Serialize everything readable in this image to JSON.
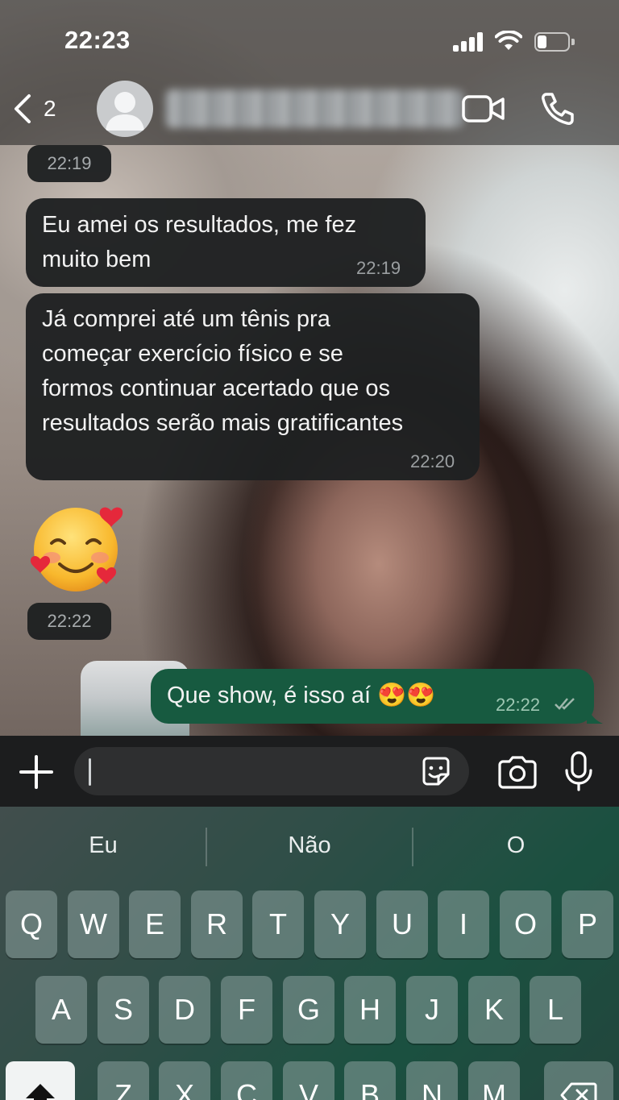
{
  "status_bar": {
    "time": "22:23"
  },
  "header": {
    "back_count": "2",
    "contact_name": "Ana Paula Rodrigues"
  },
  "messages": [
    {
      "type": "time",
      "time": "22:19"
    },
    {
      "type": "in",
      "text": "Eu amei os resultados, me fez\nmuito bem",
      "time": "22:19"
    },
    {
      "type": "in",
      "text": "Já comprei até um tênis pra\ncomeçar exercício físico e se\nformos continuar acertado que os\nresultados serão mais gratificantes",
      "time": "22:20"
    },
    {
      "type": "sticker",
      "emoji": "🥰",
      "time": "22:22"
    },
    {
      "type": "out",
      "text": "Que show, é isso aí 😍😍",
      "time": "22:22",
      "status": "read"
    }
  ],
  "input": {
    "value": "",
    "placeholder": ""
  },
  "keyboard": {
    "suggestions": [
      "Eu",
      "Não",
      "O"
    ],
    "row1": [
      "Q",
      "W",
      "E",
      "R",
      "T",
      "Y",
      "U",
      "I",
      "O",
      "P"
    ],
    "row2": [
      "A",
      "S",
      "D",
      "F",
      "G",
      "H",
      "J",
      "K",
      "L"
    ],
    "row3": [
      "Z",
      "X",
      "C",
      "V",
      "B",
      "N",
      "M"
    ]
  },
  "icons": {
    "back": "chevron-left-icon",
    "video": "video-camera-icon",
    "phone": "phone-icon",
    "plus": "plus-icon",
    "sticker": "sticker-icon",
    "camera": "camera-icon",
    "mic": "microphone-icon",
    "shift": "shift-icon",
    "delete": "backspace-icon"
  },
  "colors": {
    "incoming_bubble": "#1e2021",
    "outgoing_bubble": "#175a40",
    "keyboard_accent": "#1f6e55"
  }
}
